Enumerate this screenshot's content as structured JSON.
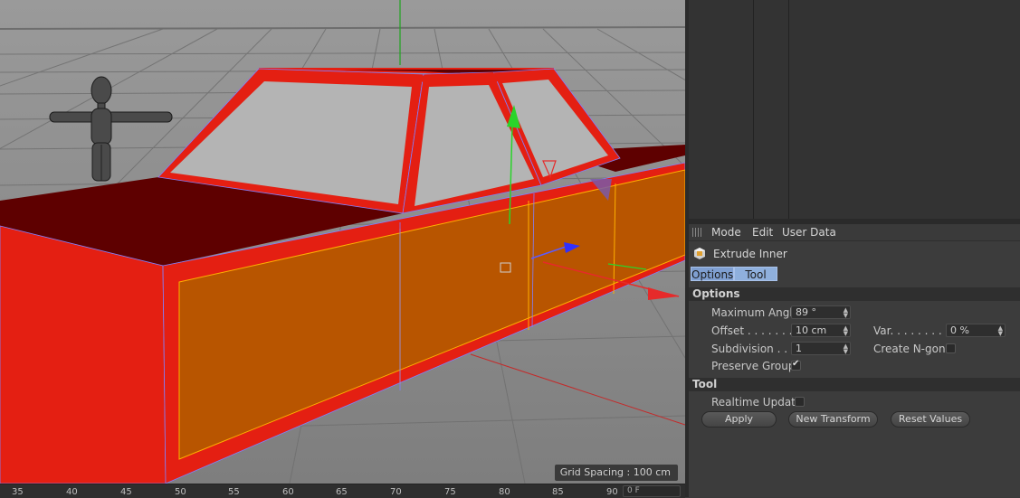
{
  "viewport": {
    "grid_spacing": "Grid Spacing : 100 cm"
  },
  "timeline": {
    "ticks": [
      "35",
      "40",
      "45",
      "50",
      "55",
      "60",
      "65",
      "70",
      "75",
      "80",
      "85",
      "90"
    ],
    "value_box": "0 F"
  },
  "attribute_manager": {
    "menu": {
      "mode": "Mode",
      "edit": "Edit",
      "user_data": "User Data"
    },
    "object_title": "Extrude Inner",
    "tabs": {
      "options": "Options",
      "tool": "Tool"
    },
    "options_section": {
      "heading": "Options",
      "maximum_angle": {
        "label": "Maximum Angle",
        "value": "89 °"
      },
      "offset": {
        "label": "Offset . . . . . . . .",
        "value": "10 cm"
      },
      "variation": {
        "label": "Var. . . . . . . . . .",
        "value": "0 %"
      },
      "subdivision": {
        "label": "Subdivision . . . .",
        "value": "1"
      },
      "create_ngons": {
        "label": "Create N-gons",
        "checked": false
      },
      "preserve_groups": {
        "label": "Preserve Groups",
        "checked": true
      }
    },
    "tool_section": {
      "heading": "Tool",
      "realtime_update": {
        "label": "Realtime Update",
        "checked": false
      },
      "apply": "Apply",
      "new_transform": "New Transform",
      "reset_values": "Reset Values"
    }
  },
  "colors": {
    "car_red": "#e41f12",
    "car_dark_red": "#5e0000",
    "selected_orange": "#b85500",
    "window_gray": "#b4b4b4",
    "tab_blue": "#7f9fd1"
  }
}
